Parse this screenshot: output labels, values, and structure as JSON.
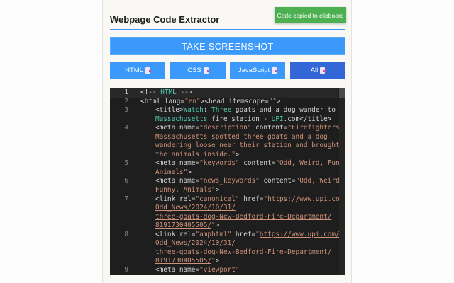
{
  "popup": {
    "title": "Webpage Code Extractor",
    "toast": "Code copied to clipboard",
    "screenshot_button": "TAKE SCREENSHOT",
    "buttons": [
      {
        "label": "HTML",
        "icon": "clipboard-icon"
      },
      {
        "label": "CSS",
        "icon": "clipboard-icon"
      },
      {
        "label": "JavaScript",
        "icon": "clipboard-icon"
      },
      {
        "label": "All",
        "icon": "clipboard-icon",
        "active": true
      }
    ]
  },
  "colors": {
    "accent": "#3b99fc",
    "active": "#3366d6",
    "toast": "#4caf50",
    "string": "#ce9178",
    "teal": "#4ec9b0"
  },
  "code_lines": [
    {
      "num": "1",
      "rows": [
        [
          [
            "p",
            "<!-- "
          ],
          [
            "t",
            "HTML"
          ],
          [
            "p",
            " -->"
          ]
        ]
      ]
    },
    {
      "num": "2",
      "rows": [
        [
          [
            "p",
            "<html lang="
          ],
          [
            "s",
            "\"en\""
          ],
          [
            "p",
            "><head itemscope="
          ],
          [
            "s",
            "\"\""
          ],
          [
            "p",
            ">"
          ]
        ]
      ]
    },
    {
      "num": "3",
      "indent": true,
      "rows": [
        [
          [
            "p",
            "<title>"
          ],
          [
            "t",
            "Watch"
          ],
          [
            "p",
            ": "
          ],
          [
            "t",
            "Three"
          ],
          [
            "p",
            " goats and a dog wander to"
          ]
        ],
        [
          [
            "t",
            "Massachusetts"
          ],
          [
            "p",
            " fire station - "
          ],
          [
            "t",
            "UPI"
          ],
          [
            "p",
            ".com</title>"
          ]
        ]
      ]
    },
    {
      "num": "4",
      "indent": true,
      "rows": [
        [
          [
            "p",
            "<meta name="
          ],
          [
            "s",
            "\"description\""
          ],
          [
            "p",
            " content="
          ],
          [
            "s",
            "\"Firefighters in"
          ]
        ],
        [
          [
            "s",
            "Massachusetts spotted three goats and a dog"
          ]
        ],
        [
          [
            "s",
            "wandering loose near their station and brought"
          ]
        ],
        [
          [
            "s",
            "the animals inside.\""
          ],
          [
            "p",
            ">"
          ]
        ]
      ]
    },
    {
      "num": "5",
      "indent": true,
      "rows": [
        [
          [
            "p",
            "<meta name="
          ],
          [
            "s",
            "\"keywords\""
          ],
          [
            "p",
            " content="
          ],
          [
            "s",
            "\"Odd, Weird, Funny,"
          ]
        ],
        [
          [
            "s",
            "Animals\""
          ],
          [
            "p",
            ">"
          ]
        ]
      ]
    },
    {
      "num": "6",
      "indent": true,
      "rows": [
        [
          [
            "p",
            "<meta name="
          ],
          [
            "s",
            "\"news_keywords\""
          ],
          [
            "p",
            " content="
          ],
          [
            "s",
            "\"Odd, Weird,"
          ]
        ],
        [
          [
            "s",
            "Funny, Animals\""
          ],
          [
            "p",
            ">"
          ]
        ]
      ]
    },
    {
      "num": "7",
      "indent": true,
      "rows": [
        [
          [
            "p",
            "<link rel="
          ],
          [
            "s",
            "\"canonical\""
          ],
          [
            "p",
            " href="
          ],
          [
            "s",
            "\""
          ],
          [
            "u",
            "https://www.upi.com/"
          ]
        ],
        [
          [
            "u",
            "Odd_News/2024/10/31/"
          ]
        ],
        [
          [
            "u",
            "three-goats-dog-New-Bedford-Fire-Department/"
          ]
        ],
        [
          [
            "u",
            "8191730405505/"
          ],
          [
            "s",
            "\""
          ],
          [
            "p",
            ">"
          ]
        ]
      ]
    },
    {
      "num": "8",
      "indent": true,
      "rows": [
        [
          [
            "p",
            "<link rel="
          ],
          [
            "s",
            "\"amphtml\""
          ],
          [
            "p",
            " href="
          ],
          [
            "s",
            "\""
          ],
          [
            "u",
            "https://www.upi.com/amp/"
          ]
        ],
        [
          [
            "u",
            "Odd_News/2024/10/31/"
          ]
        ],
        [
          [
            "u",
            "three-goats-dog-New-Bedford-Fire-Department/"
          ]
        ],
        [
          [
            "u",
            "8191730405505/"
          ],
          [
            "s",
            "\""
          ],
          [
            "p",
            ">"
          ]
        ]
      ]
    },
    {
      "num": "9",
      "indent": true,
      "rows": [
        [
          [
            "p",
            "<meta name="
          ],
          [
            "s",
            "\"viewport\""
          ]
        ]
      ]
    }
  ]
}
